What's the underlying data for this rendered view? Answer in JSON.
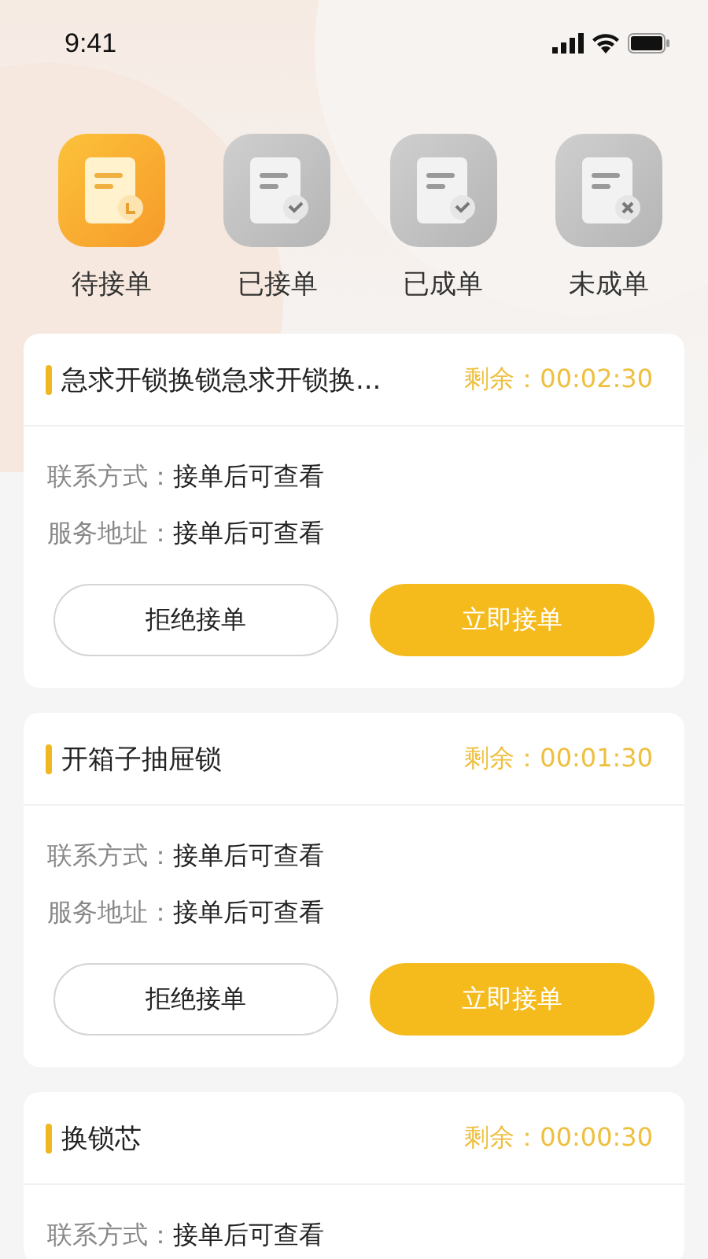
{
  "status_bar": {
    "time": "9:41"
  },
  "tabs": [
    {
      "label": "待接单",
      "kind": "pending",
      "selected": true
    },
    {
      "label": "已接单",
      "kind": "accepted",
      "selected": false
    },
    {
      "label": "已成单",
      "kind": "done",
      "selected": false
    },
    {
      "label": "未成单",
      "kind": "failed",
      "selected": false
    }
  ],
  "orders": [
    {
      "title": "急求开锁换锁急求开锁换...",
      "remaining": "剩余：00:02:30",
      "fields": [
        {
          "label": "联系方式：",
          "value": "接单后可查看"
        },
        {
          "label": "服务地址：",
          "value": "接单后可查看"
        }
      ],
      "buttons": [
        {
          "label": "拒绝接单",
          "kind": "outline"
        },
        {
          "label": "立即接单",
          "kind": "primary"
        }
      ]
    },
    {
      "title": "开箱子抽屉锁",
      "remaining": "剩余：00:01:30",
      "fields": [
        {
          "label": "联系方式：",
          "value": "接单后可查看"
        },
        {
          "label": "服务地址：",
          "value": "接单后可查看"
        }
      ],
      "buttons": [
        {
          "label": "拒绝接单",
          "kind": "outline"
        },
        {
          "label": "立即接单",
          "kind": "primary"
        }
      ]
    },
    {
      "title": "换锁芯",
      "remaining": "剩余：00:00:30",
      "fields": [
        {
          "label": "联系方式：",
          "value": "接单后可查看"
        }
      ]
    }
  ]
}
